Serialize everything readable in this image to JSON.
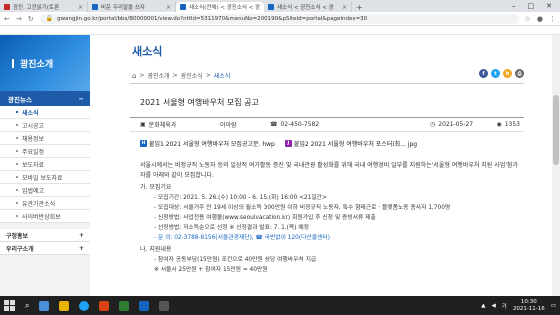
{
  "browser": {
    "tabs": [
      {
        "label": "광진. 고전읽기(토론",
        "active": false
      },
      {
        "label": "비운 우리말을 쓰자",
        "active": false
      },
      {
        "label": "새소식(전체) < 광진소식 < 광",
        "active": true
      },
      {
        "label": "새소식 < 광진소식 < 광",
        "active": false
      }
    ],
    "new_tab": "+",
    "url": "gwangjin.go.kr/portal/bbs/B0000001/view.do?nttId=5311970&menuNo=200190&pSiteId=portal&pageIndex=30"
  },
  "sidebar": {
    "header": "광진소개",
    "category": "광진뉴스",
    "category_toggle": "−",
    "items": [
      {
        "label": "새소식",
        "active": true
      },
      {
        "label": "고시공고",
        "active": false
      },
      {
        "label": "채용정보",
        "active": false
      },
      {
        "label": "주요일정",
        "active": false
      },
      {
        "label": "보도자료",
        "active": false
      },
      {
        "label": "모바일 보도자료",
        "active": false
      },
      {
        "label": "입법예고",
        "active": false
      },
      {
        "label": "유관기관소식",
        "active": false
      },
      {
        "label": "사이버반상회보",
        "active": false
      }
    ],
    "footer": [
      {
        "label": "구정홍보",
        "toggle": "+"
      },
      {
        "label": "우리구소개",
        "toggle": "+"
      }
    ]
  },
  "main": {
    "page_title": "새소식",
    "breadcrumbs": [
      "광진소개",
      "광진소식",
      "새소식"
    ],
    "post_title": "2021 서울형 여행바우처 모집 공고",
    "department": "문화체육과",
    "author": "이아람",
    "phone": "02-450-7582",
    "date": "2021-05-27",
    "views": "1353",
    "attachments": [
      {
        "label": "붙임1 2021 서울형 여행바우처 모집공고문. hwp",
        "type": "hwp"
      },
      {
        "label": "붙임2 2021 서울형 여행바우처 포스터(최... jpg",
        "type": "jpg"
      }
    ],
    "intro": "서울시에서는 비정규직 노동자 등의 일상적 여가활동 증진 및 국내관광 활성화를 위해 국내 여행경비 일부를 지원하는'서울형 여행바우처 지원 사업'참가자를 아래와 같이 모집합니다.",
    "section_a": "가.  모집기요",
    "lines_a": [
      "- 모집기간: 2021. 5. 26.(수) 10:00 - 6. 15.(화) 16:00 <21일간>",
      "- 모집대상: 서울거주 만 19세 이상의 월소득 300만원 이하 비정규직 노동자, 특수 형태근로 · 플랫폼노동 종사자 1,700명",
      "- 신청방법: 사업전용 여행몰(www.seoulvacation.kr) 회원가입 후 신청 및 증빙서류 제출",
      "- 선정방법: 저소득순으로 선정 ※ 선정결과 발표: 7. 1.(목) 예정",
      "- 문 의: 02-3788-8156(서울관광재단), ☎ 국번없이 120(다산콜센터)"
    ],
    "section_b": "나.  지원내용",
    "lines_b": [
      "- 참여자 공동부담(15만원) 조건으로 40만원 상당 여행바우처 지급",
      "※ 서울시 25만원 + 참여자 15만원 = 40만원"
    ]
  },
  "taskbar": {
    "time": "10:30",
    "date": "2021-11-16",
    "lang": "가"
  }
}
